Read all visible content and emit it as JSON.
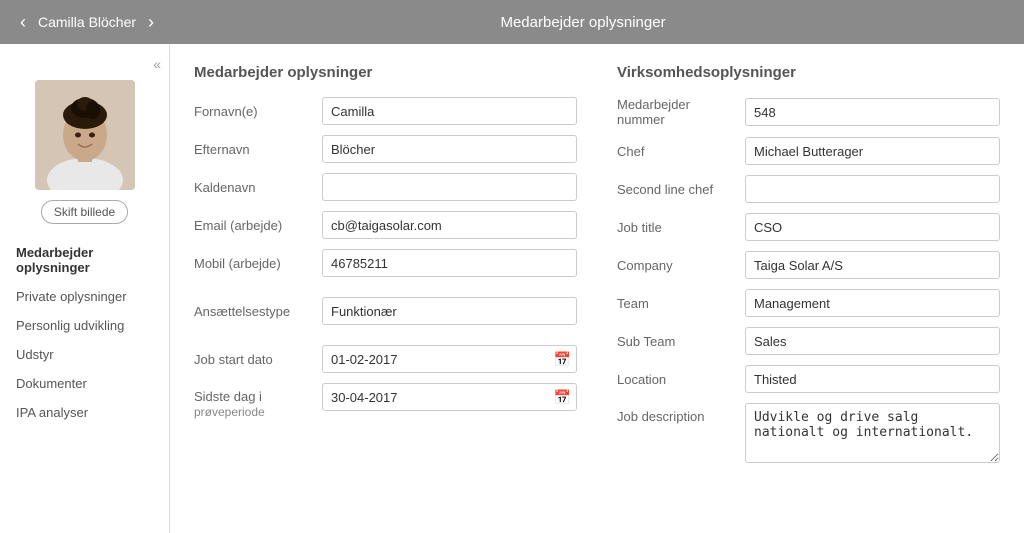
{
  "topbar": {
    "nav_back": "‹",
    "nav_forward": "›",
    "person_name": "Camilla Blöcher",
    "page_title": "Medarbejder oplysninger"
  },
  "sidebar": {
    "collapse_icon": "«",
    "change_photo_label": "Skift billede",
    "menu_items": [
      {
        "id": "medarbejder-oplysninger",
        "label": "Medarbejder oplysninger",
        "active": true
      },
      {
        "id": "private-oplysninger",
        "label": "Private oplysninger",
        "active": false
      },
      {
        "id": "personlig-udvikling",
        "label": "Personlig udvikling",
        "active": false
      },
      {
        "id": "udstyr",
        "label": "Udstyr",
        "active": false
      },
      {
        "id": "dokumenter",
        "label": "Dokumenter",
        "active": false
      },
      {
        "id": "ipa-analyser",
        "label": "IPA analyser",
        "active": false
      }
    ]
  },
  "employee_info": {
    "section_title": "Medarbejder oplysninger",
    "fields": {
      "fornavn_label": "Fornavn(e)",
      "fornavn_value": "Camilla",
      "efternavn_label": "Efternavn",
      "efternavn_value": "Blöcher",
      "kaldenavn_label": "Kaldenavn",
      "kaldenavn_value": "",
      "email_label": "Email (arbejde)",
      "email_value": "cb@taigasolar.com",
      "mobil_label": "Mobil (arbejde)",
      "mobil_value": "46785211",
      "ansaettelsestype_label": "Ansættelsestype",
      "ansaettelsestype_value": "Funktionær",
      "job_start_label": "Job start dato",
      "job_start_value": "01-02-2017",
      "sidste_dag_label": "Sidste dag i",
      "sidste_dag_sub": "prøveperiode",
      "sidste_dag_value": "30-04-2017"
    }
  },
  "company_info": {
    "section_title": "Virksomhedsoplysninger",
    "fields": {
      "medarbejder_nr_label": "Medarbejder nummer",
      "medarbejder_nr_value": "548",
      "chef_label": "Chef",
      "chef_value": "Michael Butterager",
      "second_chef_label": "Second line chef",
      "second_chef_value": "",
      "job_title_label": "Job title",
      "job_title_value": "CSO",
      "company_label": "Company",
      "company_value": "Taiga Solar A/S",
      "team_label": "Team",
      "team_value": "Management",
      "sub_team_label": "Sub Team",
      "sub_team_value": "Sales",
      "location_label": "Location",
      "location_value": "Thisted",
      "job_desc_label": "Job description",
      "job_desc_value": "Udvikle og drive salg nationalt og internationalt."
    }
  }
}
